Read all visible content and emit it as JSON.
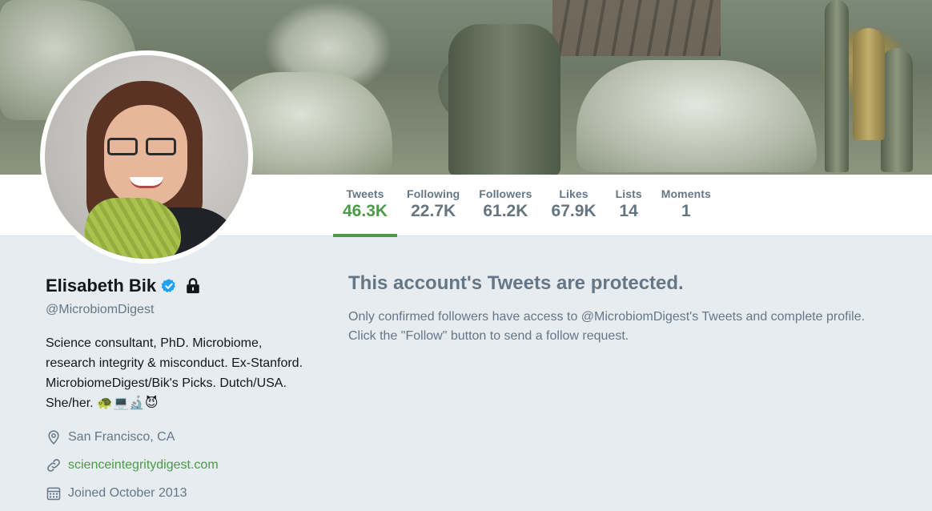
{
  "stats": [
    {
      "label": "Tweets",
      "value": "46.3K",
      "active": true
    },
    {
      "label": "Following",
      "value": "22.7K",
      "active": false
    },
    {
      "label": "Followers",
      "value": "61.2K",
      "active": false
    },
    {
      "label": "Likes",
      "value": "67.9K",
      "active": false
    },
    {
      "label": "Lists",
      "value": "14",
      "active": false
    },
    {
      "label": "Moments",
      "value": "1",
      "active": false
    }
  ],
  "profile": {
    "name": "Elisabeth Bik",
    "handle": "@MicrobiomDigest",
    "bio_text": "Science consultant, PhD. Microbiome, research integrity & misconduct. Ex-Stanford. MicrobiomeDigest/Bik's Picks. Dutch/USA. She/her.",
    "bio_emojis": "🐢💻🔬😈",
    "location": "San Francisco, CA",
    "website": "scienceintegritydigest.com",
    "joined": "Joined October 2013"
  },
  "protected": {
    "title": "This account's Tweets are protected.",
    "line1": "Only confirmed followers have access to @MicrobiomDigest's Tweets and complete profile.",
    "line2": "Click the \"Follow\" button to send a follow request."
  },
  "colors": {
    "accent": "#4a9a46",
    "muted_text": "#657786",
    "page_bg": "#e6ecf0",
    "verified": "#1da1f2"
  },
  "icons": {
    "verified": "verified-badge-icon",
    "lock": "lock-icon",
    "location": "location-pin-icon",
    "link": "link-icon",
    "calendar": "calendar-icon"
  }
}
